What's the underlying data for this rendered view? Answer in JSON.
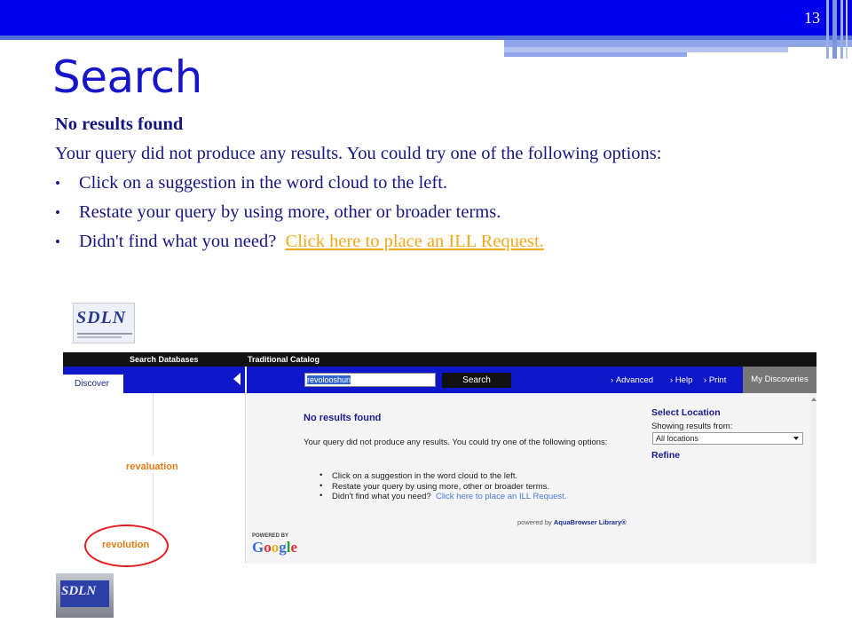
{
  "slide": {
    "number": "13",
    "title": "Search",
    "heading": "No results found",
    "paragraph": "Your query did not produce any results. You could try one of the following options:",
    "bullets": [
      "Click on a suggestion in the word cloud to the left.",
      "Restate your query by using more, other or broader terms.",
      "Didn't find what you need?"
    ],
    "ill_link": "Click here to place an ILL Request.",
    "colors": {
      "title": "#1616c8",
      "body": "#161682",
      "link": "#f0a81a",
      "band": "#0000ee"
    }
  },
  "screenshot": {
    "logo": "SDLN",
    "nav": {
      "search_databases": "Search Databases",
      "traditional_catalog": "Traditional Catalog"
    },
    "tab_discover": "Discover",
    "search": {
      "query": "revolooshun",
      "button": "Search"
    },
    "util_links": [
      "Advanced",
      "Help",
      "Print"
    ],
    "my_discoveries": "My Discoveries",
    "word_cloud": [
      "revaluation",
      "revolution"
    ],
    "results": {
      "title": "No results found",
      "text": "Your query did not produce any results. You could try one of the following options:",
      "items": [
        "Click on a suggestion in the word cloud to the left.",
        "Restate your query by using more, other or broader terms.",
        "Didn't find what you need?"
      ],
      "ill_link": "Click here to place an ILL Request.",
      "powered_prefix": "powered by",
      "powered_brand": "AquaBrowser Library®"
    },
    "google": {
      "powered_by": "POWERED BY",
      "brand": "Google"
    },
    "location": {
      "title": "Select Location",
      "label": "Showing results from:",
      "selected": "All locations",
      "refine": "Refine"
    }
  },
  "bottom_logo": "SDLN"
}
